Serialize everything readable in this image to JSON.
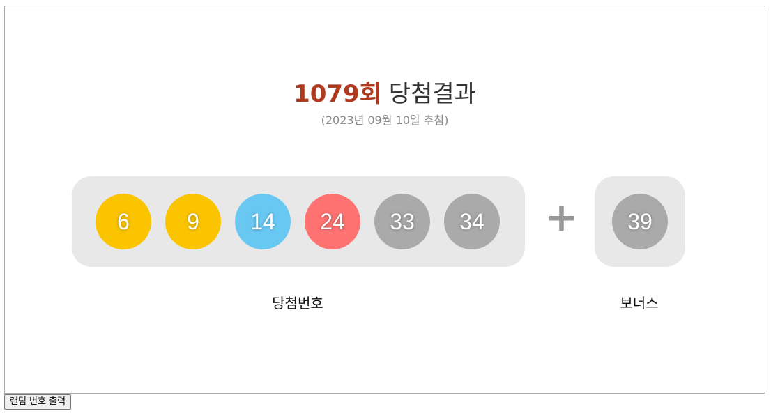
{
  "header": {
    "round": "1079회",
    "title_suffix": " 당첨결과",
    "date": "(2023년 09월 10일 추첨)"
  },
  "winning": {
    "label": "당첨번호",
    "balls": [
      {
        "number": "6",
        "color": "#fbc400"
      },
      {
        "number": "9",
        "color": "#fbc400"
      },
      {
        "number": "14",
        "color": "#69c8f2"
      },
      {
        "number": "24",
        "color": "#ff7272"
      },
      {
        "number": "33",
        "color": "#aaaaaa"
      },
      {
        "number": "34",
        "color": "#aaaaaa"
      }
    ]
  },
  "plus_sign": "+",
  "bonus": {
    "label": "보너스",
    "ball": {
      "number": "39",
      "color": "#aaaaaa"
    }
  },
  "controls": {
    "random_button_label": "랜덤 번호 출력"
  }
}
